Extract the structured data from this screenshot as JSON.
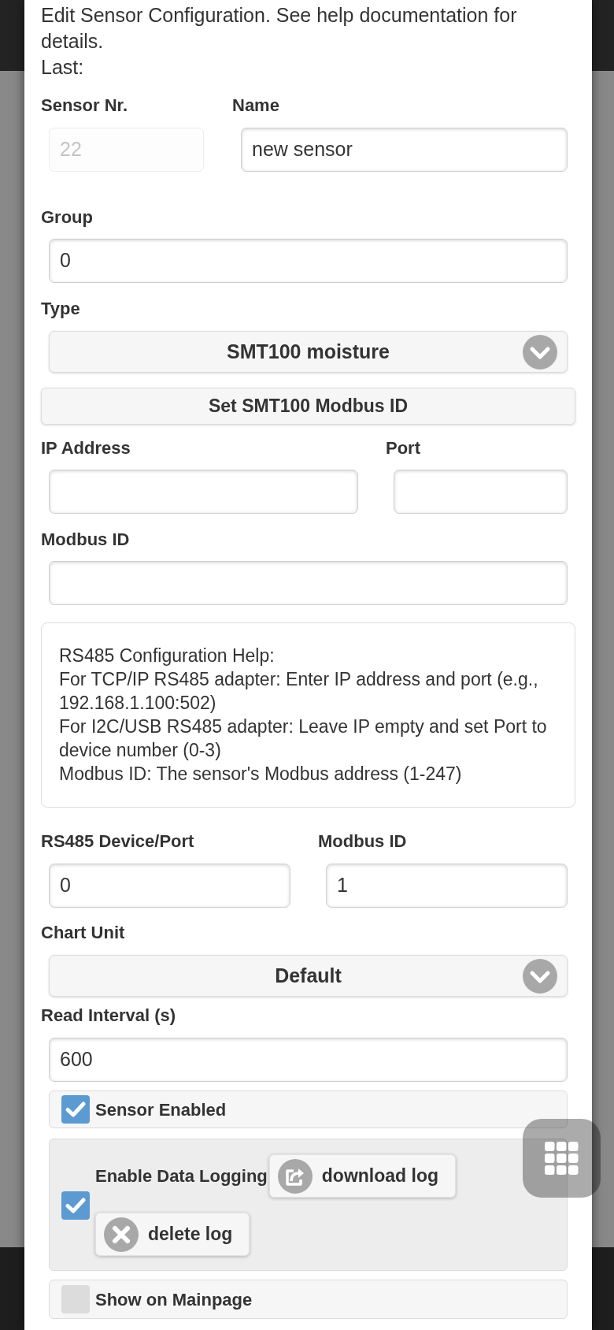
{
  "intro": {
    "text": "Edit Sensor Configuration. See help documentation for details.",
    "last": "Last:"
  },
  "sensor_nr": {
    "label": "Sensor Nr.",
    "value": "22",
    "disabled": true
  },
  "name": {
    "label": "Name",
    "value": "new sensor"
  },
  "group": {
    "label": "Group",
    "value": "0"
  },
  "type": {
    "label": "Type",
    "value": "SMT100 moisture"
  },
  "set_modbus_button": "Set SMT100 Modbus ID",
  "ip_address": {
    "label": "IP Address"
  },
  "port": {
    "label": "Port"
  },
  "modbus_id": {
    "label": "Modbus ID"
  },
  "help": {
    "lines": [
      "RS485 Configuration Help:",
      "For TCP/IP RS485 adapter: Enter IP address and port (e.g., 192.168.1.100:502)",
      "For I2C/USB RS485 adapter: Leave IP empty and set Port to device number (0-3)",
      "Modbus ID: The sensor's Modbus address (1-247)"
    ]
  },
  "rs485_port": {
    "label": "RS485 Device/Port",
    "value": "0"
  },
  "rs485_modbus_id": {
    "label": "Modbus ID",
    "value": "1"
  },
  "chart_unit": {
    "label": "Chart Unit",
    "value": "Default"
  },
  "read_interval": {
    "label": "Read Interval (s)",
    "value": "600"
  },
  "sensor_enabled": {
    "label": "Sensor Enabled",
    "checked": true
  },
  "data_logging": {
    "label": "Enable Data Logging",
    "checked": true,
    "buttons": [
      {
        "kind": "download",
        "label": "download log"
      },
      {
        "kind": "delete",
        "label": "delete log"
      }
    ]
  },
  "show_on_mainpage": {
    "label": "Show on Mainpage",
    "checked": false
  }
}
